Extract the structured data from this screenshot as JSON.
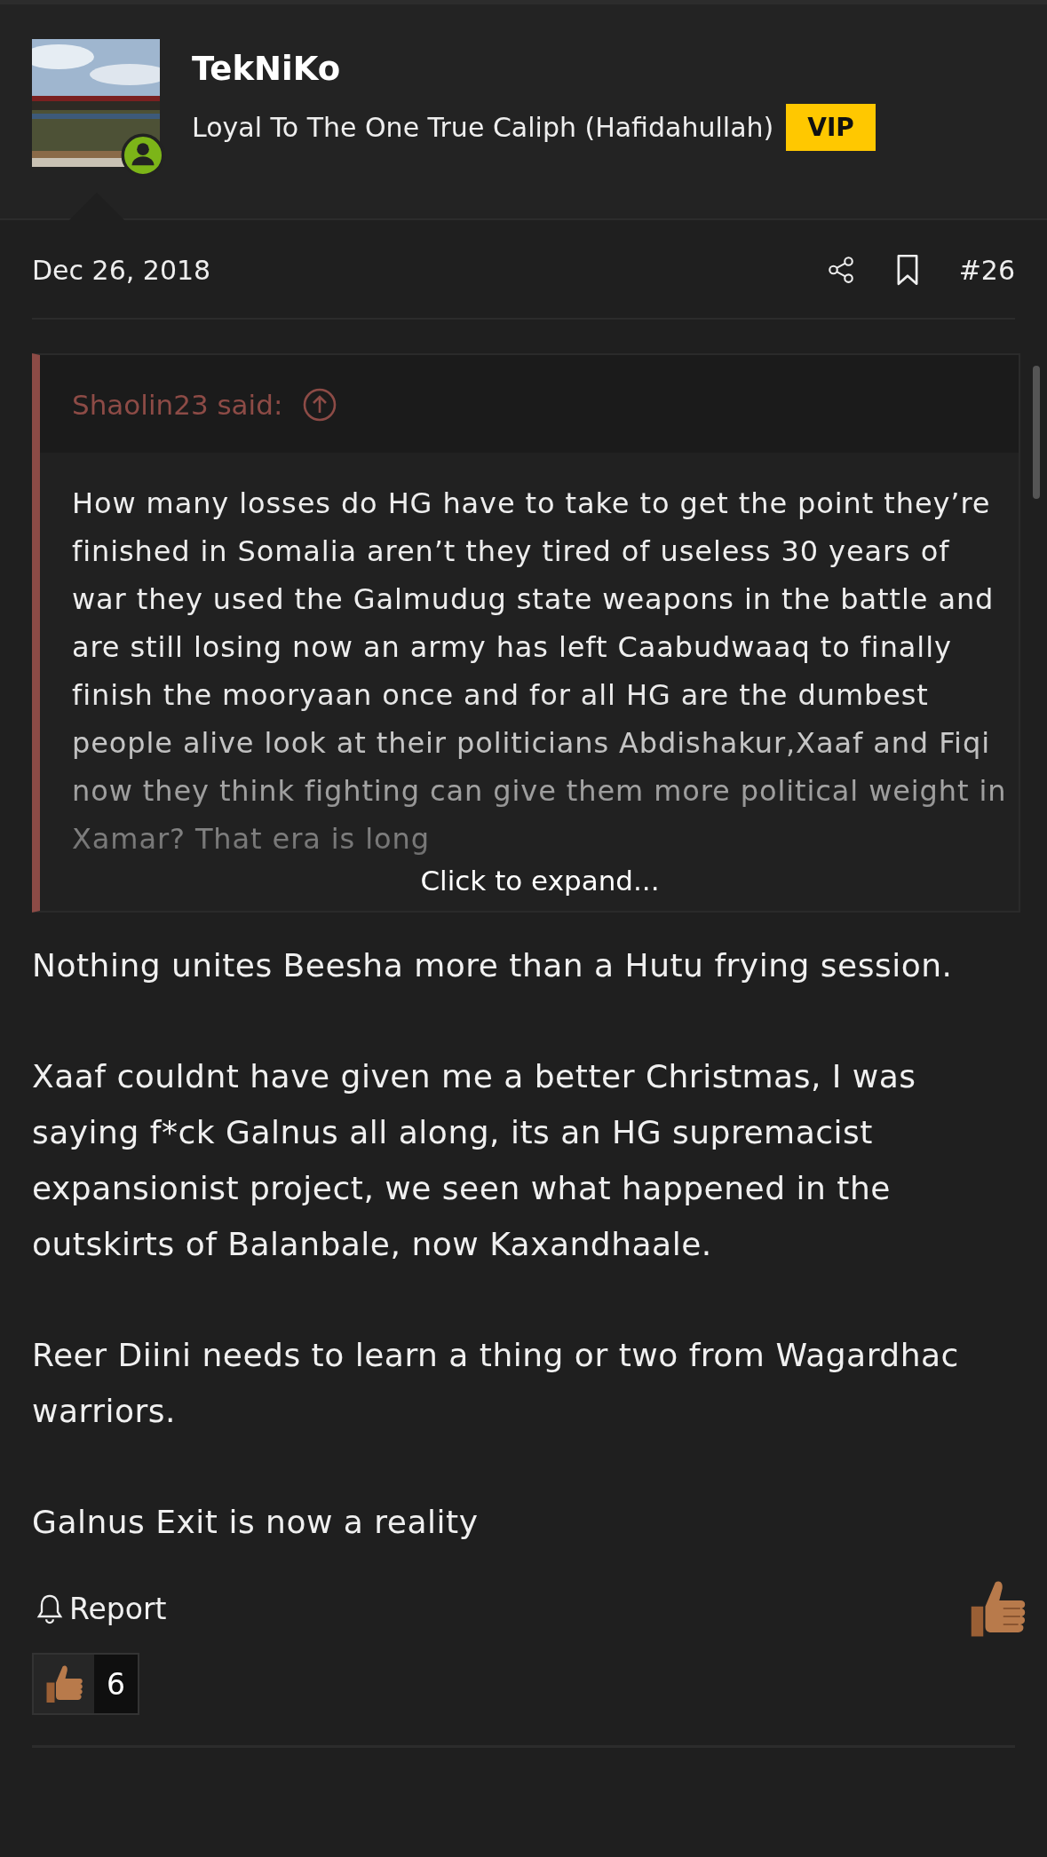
{
  "author": {
    "name": "TekNiKo",
    "title": "Loyal To The One True Caliph (Hafidahullah)",
    "badge": "VIP",
    "online": true
  },
  "post": {
    "date": "Dec 26, 2018",
    "number": "#26"
  },
  "quote": {
    "author": "Shaolin23 said:",
    "text": "How many losses do HG have to take to get the point they’re finished in Somalia aren’t they tired of useless 30 years of war they used the Galmudug state weapons in the battle and are still losing now an army has left Caabudwaaq to finally finish the mooryaan once and for all HG are the dumbest people alive look at their politicians Abdishakur,Xaaf and Fiqi now they think fighting can give them more political weight in Xamar? That era is long",
    "expand": "Click to expand..."
  },
  "body": [
    "Nothing unites Beesha more than a Hutu frying session.",
    "Xaaf couldnt have given me a better Christmas, I was saying f*ck Galnus all along, its an HG supremacist expansionist project, we seen what happened in the outskirts of Balanbale, now Kaxandhaale.",
    "Reer Diini needs to learn a thing or two from Wagardhac warriors.",
    "Galnus Exit is now a reality"
  ],
  "actions": {
    "report": "Report"
  },
  "reactions": [
    {
      "count": "6"
    }
  ]
}
